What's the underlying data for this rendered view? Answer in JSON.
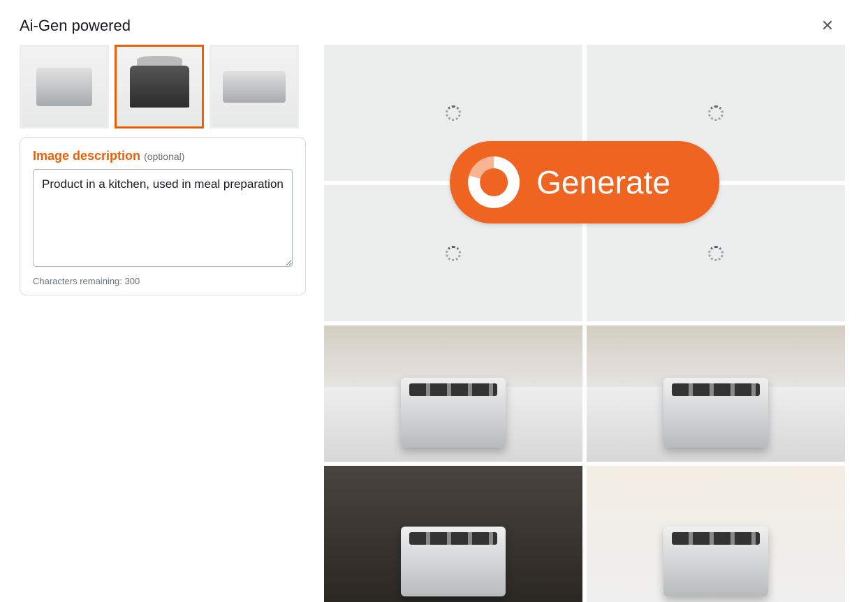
{
  "header": {
    "title": "Ai-Gen powered"
  },
  "thumbnails": [
    {
      "name": "toaster",
      "selected": false
    },
    {
      "name": "slow-cooker",
      "selected": true
    },
    {
      "name": "electric-fryer",
      "selected": false
    }
  ],
  "description": {
    "label": "Image description",
    "optional_hint": "(optional)",
    "value": "Product in a kitchen, used in meal preparation",
    "chars_remaining_label": "Characters remaining: 300"
  },
  "generate": {
    "label": "Generate"
  },
  "colors": {
    "accent": "#eb5f07",
    "generate_bg": "#ef6421"
  }
}
